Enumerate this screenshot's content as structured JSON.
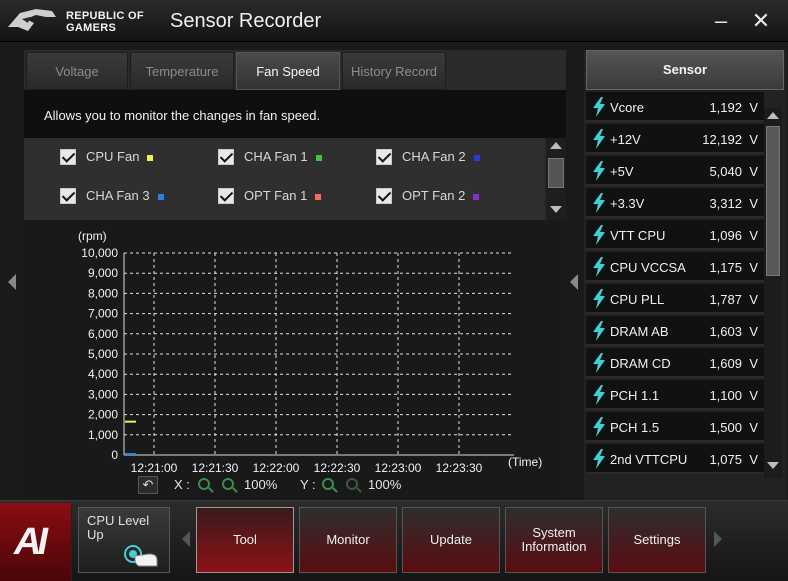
{
  "header": {
    "brand_line1": "REPUBLIC OF",
    "brand_line2": "GAMERS",
    "title": "Sensor Recorder",
    "minimize_glyph": "–",
    "close_glyph": "✕"
  },
  "tabs": [
    {
      "label": "Voltage",
      "active": false
    },
    {
      "label": "Temperature",
      "active": false
    },
    {
      "label": "Fan Speed",
      "active": true
    },
    {
      "label": "History Record",
      "active": false
    }
  ],
  "description": "Allows you to monitor the changes in fan speed.",
  "fans": [
    {
      "label": "CPU Fan",
      "checked": true,
      "color": "#f0f050"
    },
    {
      "label": "CHA Fan 1",
      "checked": true,
      "color": "#3cc83c"
    },
    {
      "label": "CHA Fan 2",
      "checked": true,
      "color": "#2a3cd2"
    },
    {
      "label": "CHA Fan 3",
      "checked": true,
      "color": "#2a80e6"
    },
    {
      "label": "OPT Fan 1",
      "checked": true,
      "color": "#f07060"
    },
    {
      "label": "OPT Fan 2",
      "checked": true,
      "color": "#8030d0"
    }
  ],
  "chart_data": {
    "type": "line",
    "ylabel": "(rpm)",
    "xlabel": "(Time)",
    "y_ticks": [
      "10,000",
      "9,000",
      "8,000",
      "7,000",
      "6,000",
      "5,000",
      "4,000",
      "3,000",
      "2,000",
      "1,000",
      "0"
    ],
    "x_ticks": [
      "12:21:00",
      "12:21:30",
      "12:22:00",
      "12:22:30",
      "12:23:00",
      "12:23:30"
    ],
    "ylim": [
      0,
      10000
    ],
    "grid": true,
    "series": [
      {
        "name": "CPU Fan",
        "color": "#f0f050",
        "values": [
          1650
        ]
      },
      {
        "name": "CHA Fan 3",
        "color": "#2a80e6",
        "values": [
          0
        ]
      }
    ]
  },
  "controls": {
    "reset_glyph": "↶",
    "x_label": "X :",
    "x_zoom": "100%",
    "y_label": "Y :",
    "y_zoom": "100%"
  },
  "sensor_panel": {
    "title": "Sensor",
    "items": [
      {
        "name": "Vcore",
        "value": "1,192",
        "unit": "V"
      },
      {
        "name": "+12V",
        "value": "12,192",
        "unit": "V"
      },
      {
        "name": "+5V",
        "value": "5,040",
        "unit": "V"
      },
      {
        "name": "+3.3V",
        "value": "3,312",
        "unit": "V"
      },
      {
        "name": "VTT CPU",
        "value": "1,096",
        "unit": "V"
      },
      {
        "name": "CPU VCCSA",
        "value": "1,175",
        "unit": "V"
      },
      {
        "name": "CPU PLL",
        "value": "1,787",
        "unit": "V"
      },
      {
        "name": "DRAM AB",
        "value": "1,603",
        "unit": "V"
      },
      {
        "name": "DRAM CD",
        "value": "1,609",
        "unit": "V"
      },
      {
        "name": "PCH 1.1",
        "value": "1,100",
        "unit": "V"
      },
      {
        "name": "PCH 1.5",
        "value": "1,500",
        "unit": "V"
      },
      {
        "name": "2nd VTTCPU",
        "value": "1,075",
        "unit": "V"
      }
    ]
  },
  "dock": {
    "logo_text": "AI",
    "cpu_level_up": "CPU Level Up",
    "buttons": [
      {
        "label": "Tool",
        "active": true
      },
      {
        "label": "Monitor",
        "active": false
      },
      {
        "label": "Update",
        "active": false
      },
      {
        "label": "System Information",
        "active": false
      },
      {
        "label": "Settings",
        "active": false
      }
    ]
  },
  "colors": {
    "accent_red": "#8c1218",
    "bolt_cyan": "#3fd0d8"
  }
}
